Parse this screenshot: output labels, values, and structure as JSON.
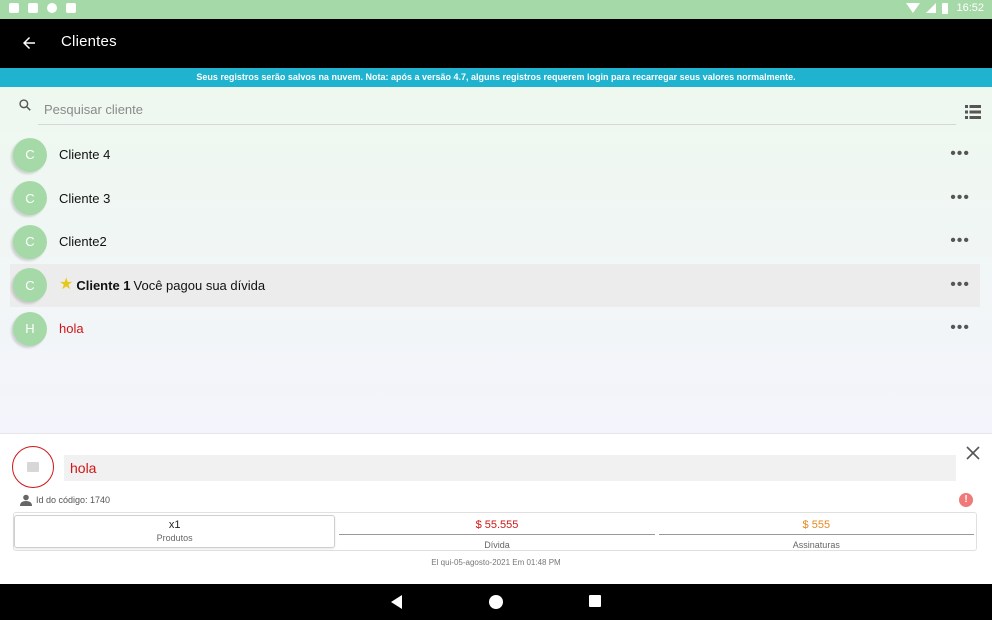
{
  "status_bar": {
    "time": "16:52"
  },
  "app_bar": {
    "title": "Clientes",
    "back_icon": "arrow-back-icon"
  },
  "banner": {
    "text": "Seus registros serão salvos na nuvem. Nota: após a versão 4.7, alguns registros requerem login para recarregar seus valores normalmente."
  },
  "search": {
    "placeholder": "Pesquisar cliente",
    "value": ""
  },
  "clients": [
    {
      "initial": "C",
      "name": "Cliente 4",
      "note": ""
    },
    {
      "initial": "C",
      "name": "Cliente 3",
      "note": ""
    },
    {
      "initial": "C",
      "name": "Cliente2",
      "note": ""
    },
    {
      "initial": "C",
      "name": "Cliente 1",
      "note": "Você pagou sua dívida",
      "starred": true,
      "selected": true
    },
    {
      "initial": "H",
      "name": "hola",
      "note": "",
      "color": "#d01616"
    }
  ],
  "detail": {
    "name": "hola",
    "id_label": "Id do código: 1740",
    "products_value": "x1",
    "products_label": "Produtos",
    "debt_value": "$ 55.555",
    "debt_label": "Dívida",
    "subs_value": "$ 555",
    "subs_label": "Assinaturas",
    "date": "El qui-05-agosto-2021 Em 01:48 PM"
  },
  "colors": {
    "accent_green": "#a6d9a8",
    "banner_blue": "#1fb3cf",
    "debt_red": "#d01616",
    "subs_orange": "#e8871f"
  }
}
